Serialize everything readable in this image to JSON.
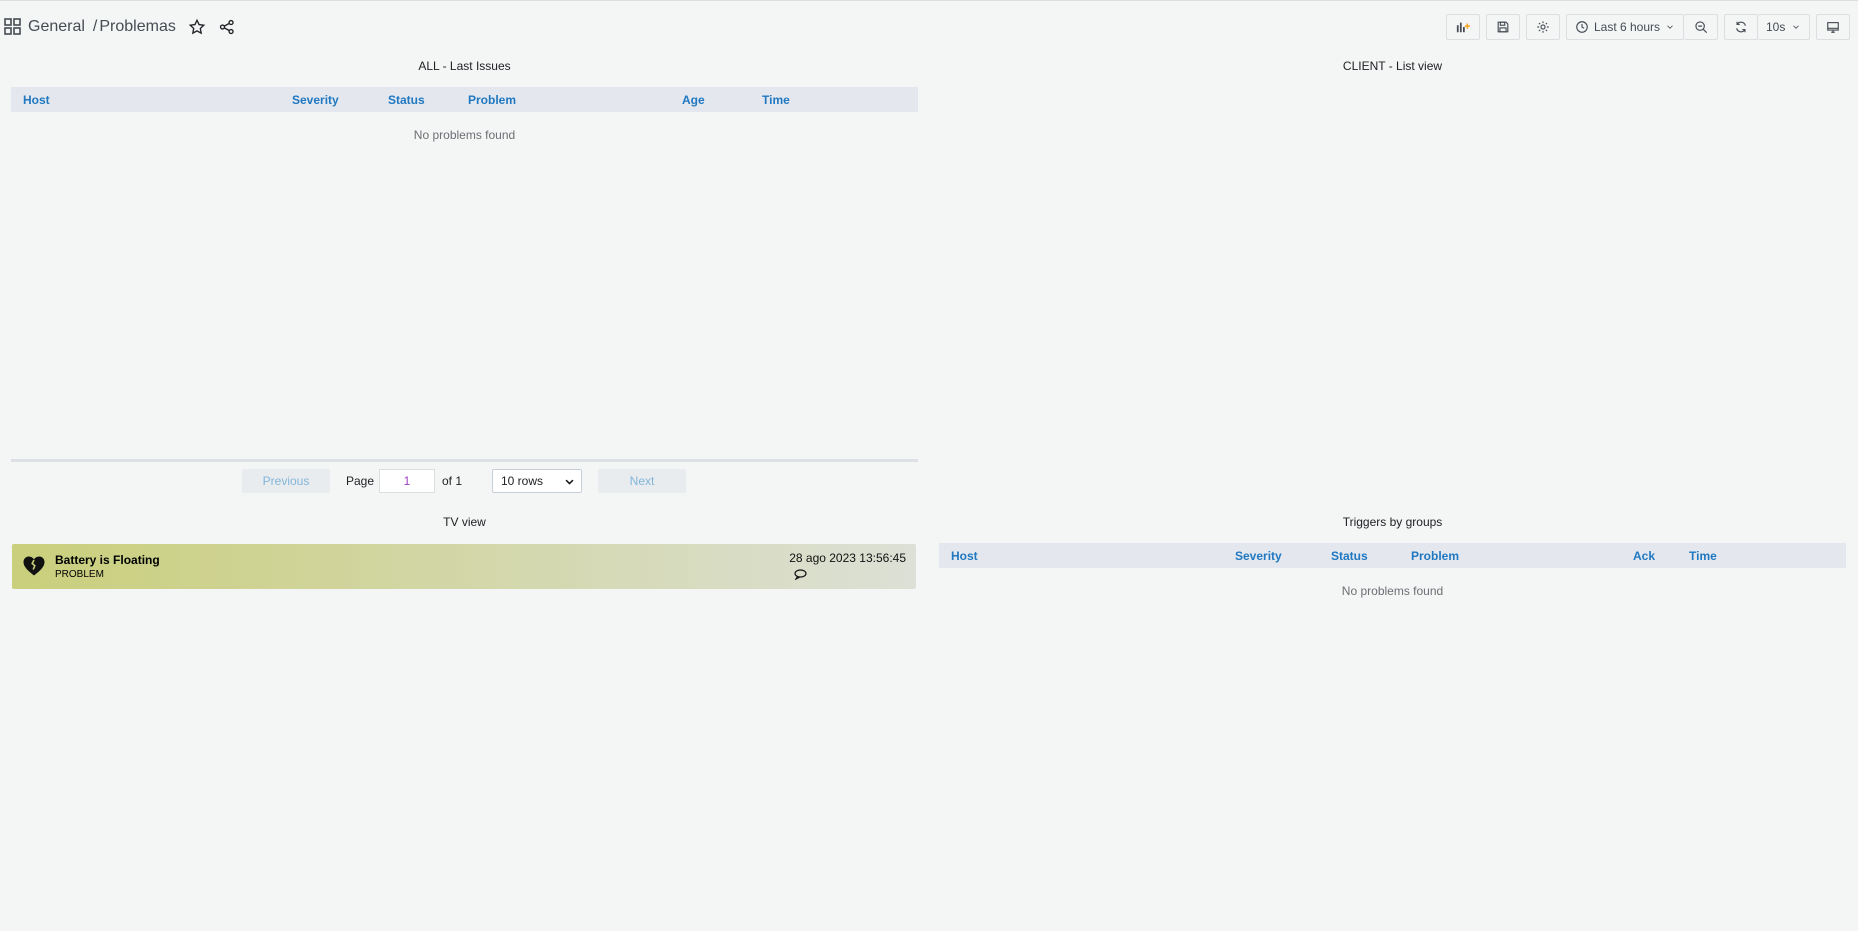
{
  "breadcrumb": {
    "folder": "General",
    "separator": "/",
    "dashboard": "Problemas"
  },
  "toolbar": {
    "time_range": "Last 6 hours",
    "refresh_interval": "10s"
  },
  "panels": {
    "last_issues": {
      "title": "ALL - Last Issues",
      "columns": [
        "Host",
        "Severity",
        "Status",
        "Problem",
        "Age",
        "Time"
      ],
      "empty_text": "No problems found",
      "pager": {
        "previous": "Previous",
        "page_label": "Page",
        "page_value": "1",
        "of_label": "of 1",
        "rows_option": "10 rows",
        "next": "Next"
      }
    },
    "client_list": {
      "title": "CLIENT - List view"
    },
    "tv_view": {
      "title": "TV view",
      "problem": {
        "name": "Battery is Floating",
        "status": "PROBLEM",
        "timestamp": "28 ago 2023 13:56:45"
      }
    },
    "triggers_by_groups": {
      "title": "Triggers by groups",
      "columns": [
        "Host",
        "Severity",
        "Status",
        "Problem",
        "Ack",
        "Time"
      ],
      "empty_text": "No problems found"
    }
  },
  "colors": {
    "header_bg": "#e4e8ee",
    "header_text": "#1f78c1",
    "tv_card_start": "#c9cf7b"
  }
}
